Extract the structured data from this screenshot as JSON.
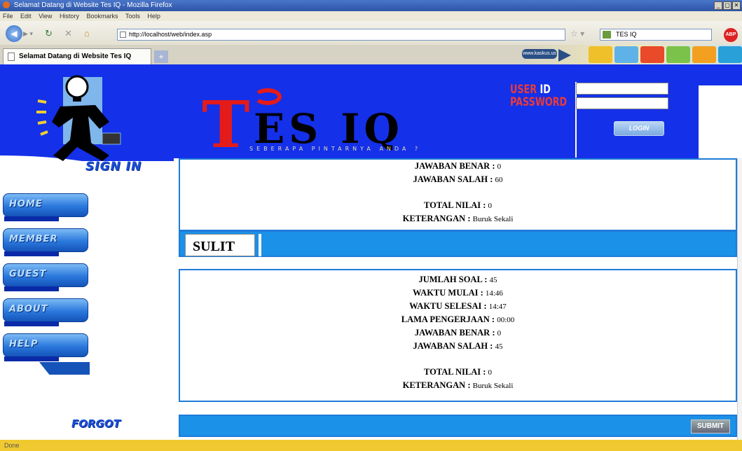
{
  "browser": {
    "window_title": "Selamat Datang di Website Tes IQ - Mozilla Firefox",
    "window_controls": [
      "_",
      "▢",
      "✕"
    ],
    "menu": [
      "File",
      "Edit",
      "View",
      "History",
      "Bookmarks",
      "Tools",
      "Help"
    ],
    "url": "http://localhost/web/index.asp",
    "search_value": "TES IQ",
    "tab_title": "Selamat Datang di Website Tes IQ",
    "new_tab": "+",
    "bookmark_badge": "www.kaskus.us",
    "abp_label": "ABP",
    "status": "Done"
  },
  "site": {
    "title_T": "T",
    "title_rest": "ES IQ",
    "subtitle": "SEBERAPA PINTARNYA ANDA ?",
    "login": {
      "user_label": "USER",
      "id_label": "ID",
      "password_label": "PASSWORD",
      "user_value": "",
      "password_value": "",
      "login_button": "LOGIN"
    },
    "sidebar": {
      "signin": "SIGN IN",
      "items": [
        {
          "label": "HOME"
        },
        {
          "label": "MEMBER"
        },
        {
          "label": "GUEST"
        },
        {
          "label": "ABOUT"
        },
        {
          "label": "HELP"
        }
      ],
      "forgot": "FORGOT"
    }
  },
  "results": {
    "first_box": {
      "jawaban_benar_label": "JAWABAN BENAR :",
      "jawaban_benar": "0",
      "jawaban_salah_label": "JAWABAN SALAH :",
      "jawaban_salah": "60",
      "total_nilai_label": "TOTAL NILAI :",
      "total_nilai": "0",
      "keterangan_label": "KETERANGAN :",
      "keterangan": "Buruk Sekali"
    },
    "level_label": "SULIT",
    "second_box": {
      "jumlah_soal_label": "JUMLAH SOAL :",
      "jumlah_soal": "45",
      "waktu_mulai_label": "WAKTU MULAI :",
      "waktu_mulai": "14:46",
      "waktu_selesai_label": "WAKTU SELESAI :",
      "waktu_selesai": "14:47",
      "lama_label": "LAMA PENGERJAAN :",
      "lama": "00:00",
      "jawaban_benar_label": "JAWABAN BENAR :",
      "jawaban_benar": "0",
      "jawaban_salah_label": "JAWABAN SALAH :",
      "jawaban_salah": "45",
      "total_nilai_label": "TOTAL NILAI :",
      "total_nilai": "0",
      "keterangan_label": "KETERANGAN :",
      "keterangan": "Buruk Sekali"
    },
    "submit": "SUBMIT"
  },
  "colors": {
    "header_blue": "#1430e8",
    "bar_blue": "#1b91e8",
    "accent_red": "#e41b1b"
  }
}
